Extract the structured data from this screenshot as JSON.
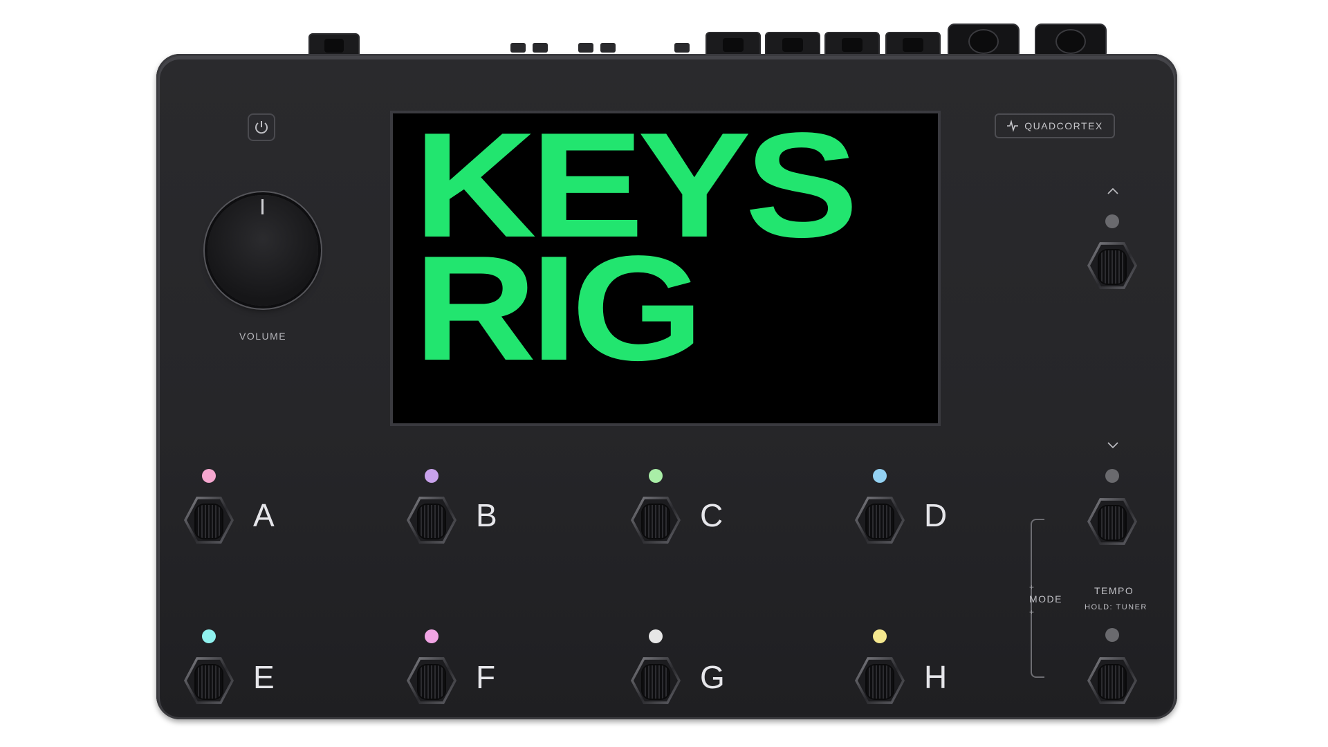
{
  "device": {
    "volume_label": "VOLUME",
    "brand": "QUADCORTEX",
    "screen": {
      "line1": "KEYS",
      "line2": "RIG",
      "text_color": "#22e56f",
      "background": "#000000"
    },
    "up_chevron": "^",
    "down_chevron": "v"
  },
  "footswitches": [
    {
      "letter": "A",
      "led_color": "#f5a7cf"
    },
    {
      "letter": "B",
      "led_color": "#c9a2ec"
    },
    {
      "letter": "C",
      "led_color": "#a9eea7"
    },
    {
      "letter": "D",
      "led_color": "#94d2f3"
    },
    {
      "letter": "E",
      "led_color": "#8ff1ee"
    },
    {
      "letter": "F",
      "led_color": "#f1a4e4"
    },
    {
      "letter": "G",
      "led_color": "#e6e6e6"
    },
    {
      "letter": "H",
      "led_color": "#f5e88f"
    }
  ],
  "right_column": {
    "mode_label": "MODE",
    "tempo_label": "TEMPO",
    "hold_label": "HOLD: TUNER",
    "plus": "+",
    "led_color": "#6a6a6e"
  },
  "icons": {
    "power": "power-icon",
    "brand_logo": "waveform-logo-icon"
  }
}
